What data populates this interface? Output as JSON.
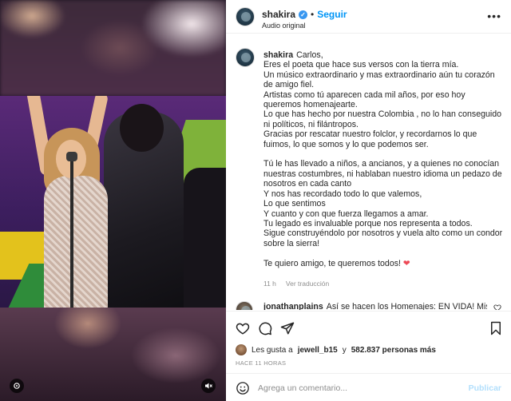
{
  "post": {
    "username": "shakira",
    "follow_label": "Seguir",
    "separator": "•",
    "audio_label": "Audio original",
    "more_label": "•••"
  },
  "caption": {
    "username": "shakira",
    "lines": [
      "Carlos,",
      "Eres el poeta que hace sus versos con la tierra mía.",
      "Un músico extraordinario y mas extraordinario aún tu corazón de amigo fiel.",
      "Artistas como tú aparecen cada mil años, por eso hoy queremos homenajearte.",
      "Lo que has hecho por nuestra Colombia , no lo han conseguido ni políticos, ni filántropos.",
      "Gracias por rescatar nuestro folclor, y recordarnos lo que fuimos, lo que somos y lo que podemos ser.",
      "",
      "Tú le has llevado a niños, a ancianos, y a quienes no conocían nuestras costumbres, ni hablaban nuestro idioma un pedazo de nosotros en cada canto",
      "Y nos has recordado todo lo que valemos,",
      "Lo que sentimos",
      "Y cuanto y con que fuerza llegamos a amar.",
      "Tu legado es invaluable porque nos representa a todos.",
      "Sigue construyéndolo por nosotros y vuela alto como un condor sobre la sierra!",
      "",
      "Te quiero amigo, te queremos todos!"
    ],
    "heart": "❤",
    "time_ago": "11 h",
    "translate_label": "Ver traducción"
  },
  "comment": {
    "username": "jonathanplains",
    "text": "Así se hacen los Homenajes: EN VIDA! Mis dos"
  },
  "likes": {
    "prefix": "Les gusta a",
    "user": "jewell_b15",
    "connector": "y",
    "count": "582.837 personas más"
  },
  "timestamp": "HACE 11 HORAS",
  "composer": {
    "placeholder": "Agrega un comentario...",
    "publish_label": "Publicar"
  },
  "colors": {
    "accent": "#0095f6",
    "publish_disabled": "#b2dffc",
    "verified": "#3897f0",
    "heart": "#ed4956"
  }
}
